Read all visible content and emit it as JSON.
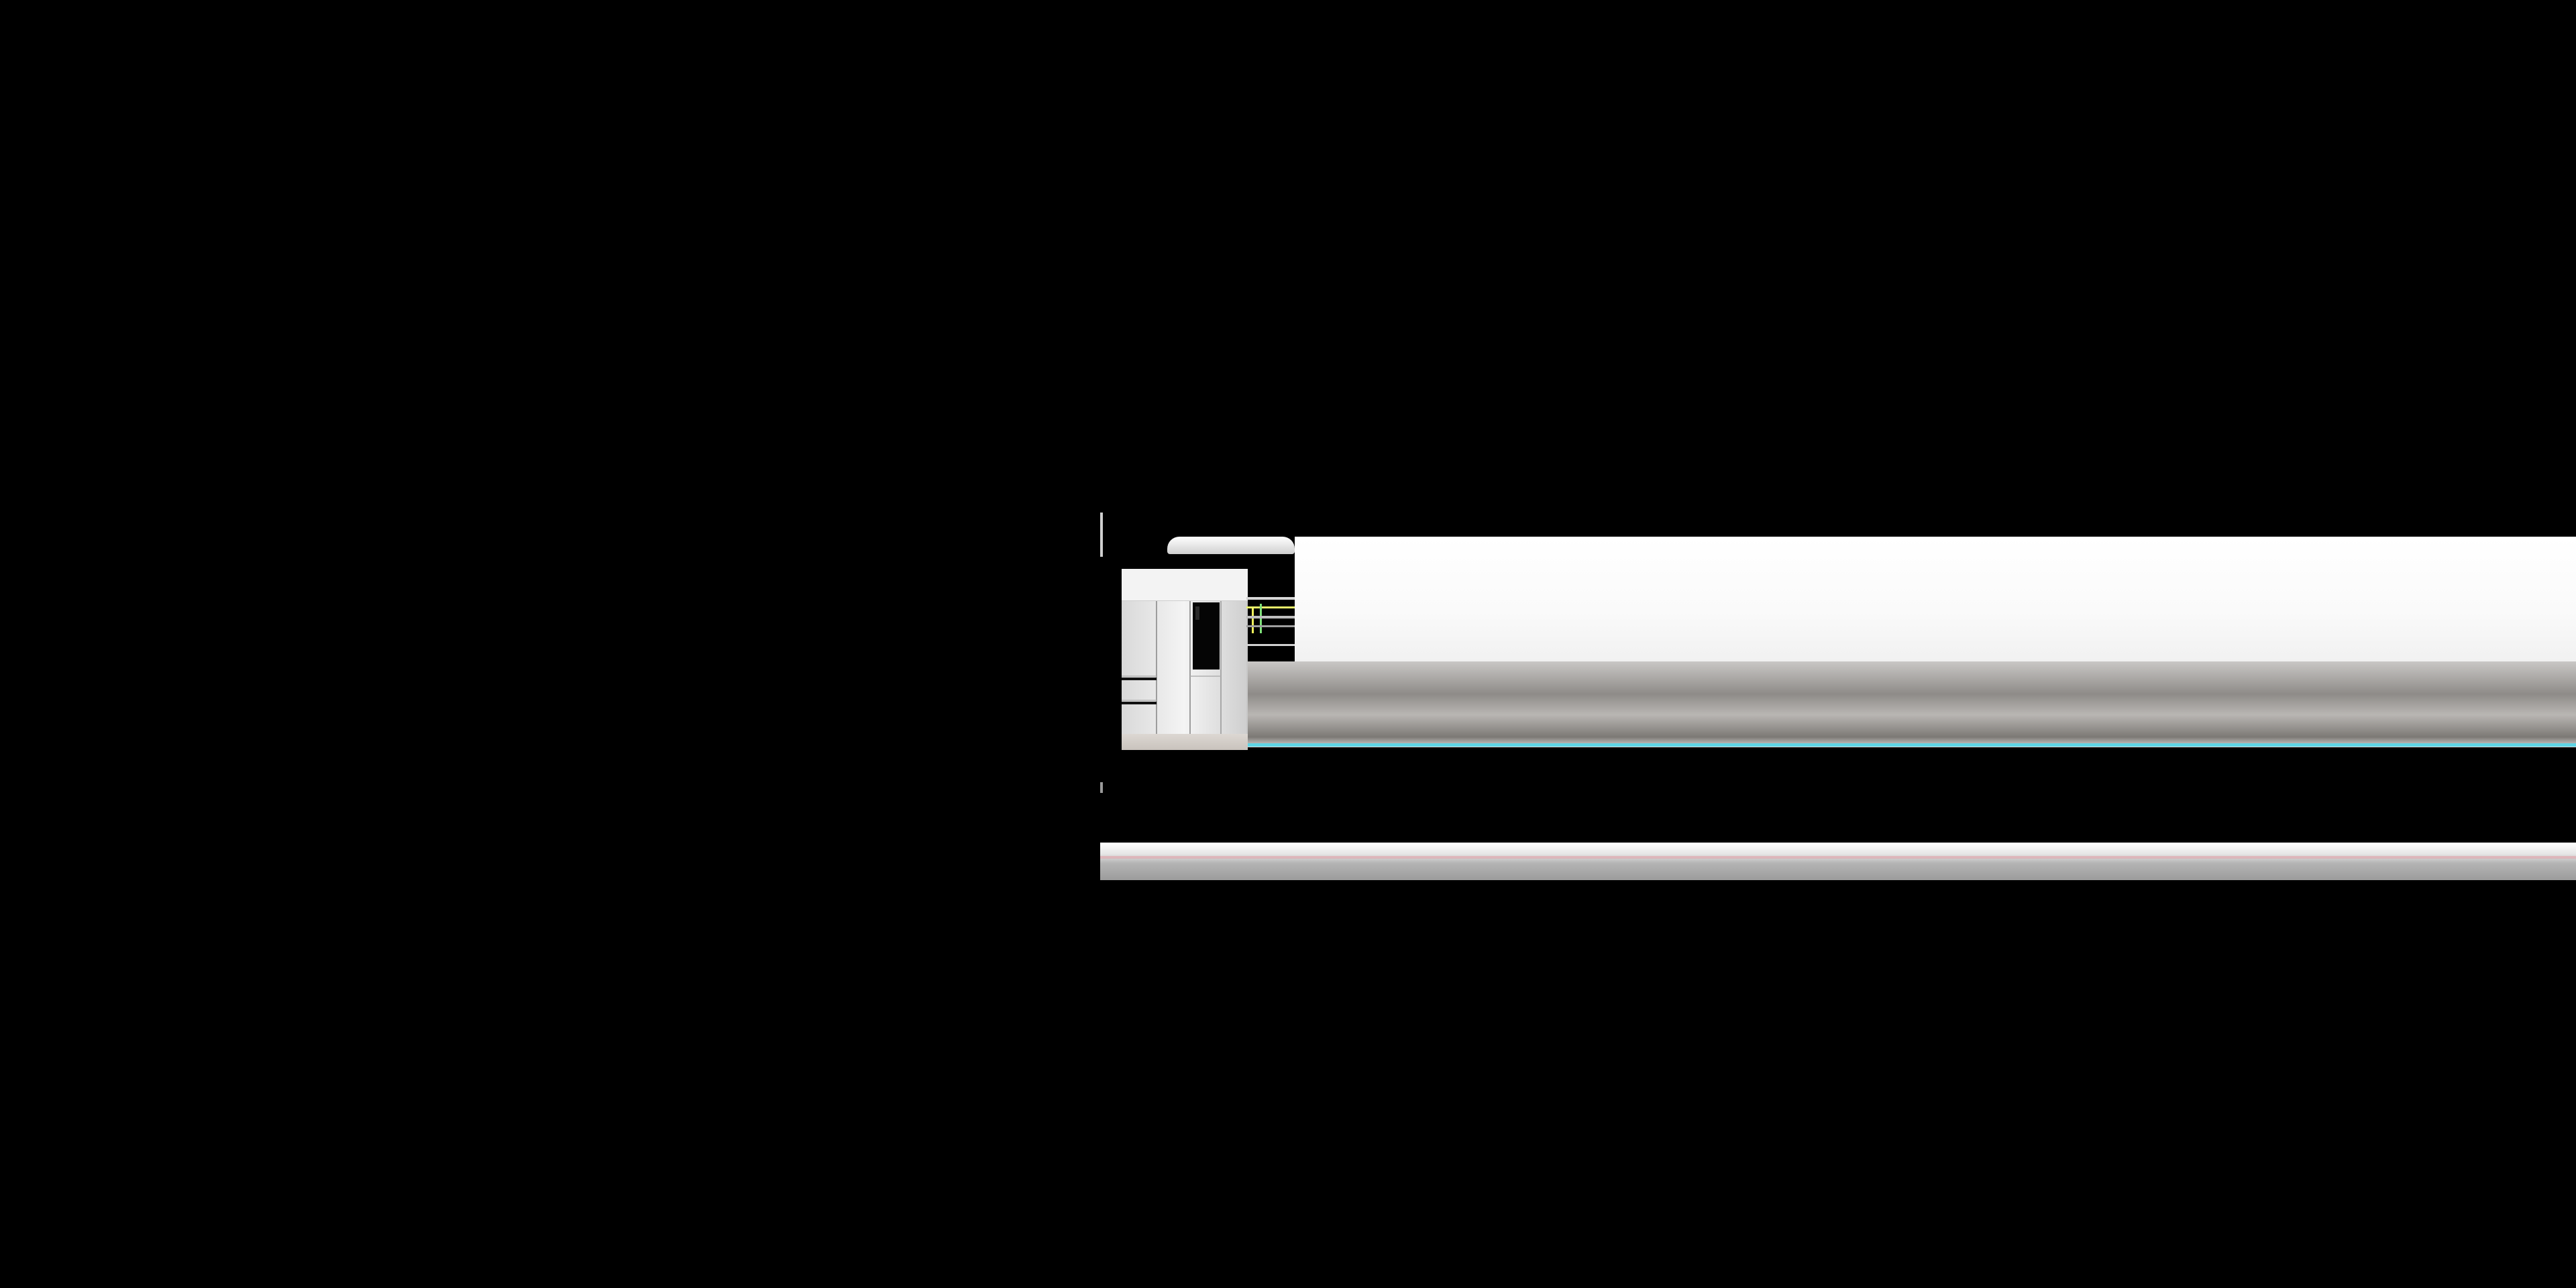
{
  "page": {
    "background": "#000000"
  },
  "image": {
    "alt": "",
    "subject_icon": "refrigerator-icon",
    "colors": {
      "body": "#e8e8e8",
      "shadow": "#9a9a9a",
      "panel": "#050505",
      "teal_edge": "#5ed4e4",
      "pink_edge": "#e2a4aa"
    }
  }
}
